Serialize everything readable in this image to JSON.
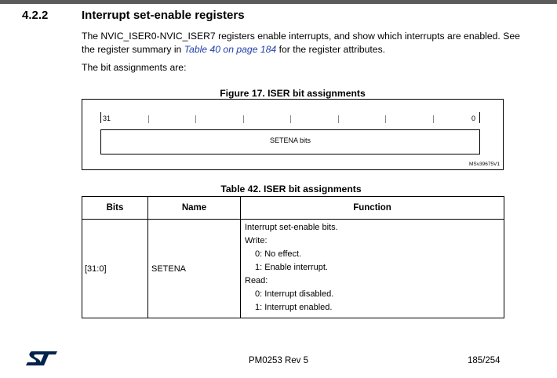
{
  "section": {
    "number": "4.2.2",
    "title": "Interrupt set-enable registers"
  },
  "intro": {
    "part1": "The NVIC_ISER0-NVIC_ISER7 registers enable interrupts, and show which interrupts are enabled. See the register summary in ",
    "link": "Table 40 on page 184",
    "part2": " for the register attributes.",
    "bit_assign": "The bit assignments are:"
  },
  "figure": {
    "caption": "Figure 17. ISER bit assignments",
    "high_bit": "31",
    "low_bit": "0",
    "field_label": "SETENA bits",
    "ref_code": "MSv39675V1"
  },
  "table": {
    "caption": "Table 42. ISER bit assignments",
    "headers": [
      "Bits",
      "Name",
      "Function"
    ],
    "row": {
      "bits": "[31:0]",
      "name": "SETENA",
      "function": [
        "Interrupt set-enable bits.",
        "Write:",
        "0: No effect.",
        "1: Enable interrupt.",
        "Read:",
        "0: Interrupt disabled.",
        "1: Interrupt enabled."
      ]
    }
  },
  "footer": {
    "doc_id": "PM0253 Rev 5",
    "page": "185/254",
    "logo_color": "#03234b"
  }
}
